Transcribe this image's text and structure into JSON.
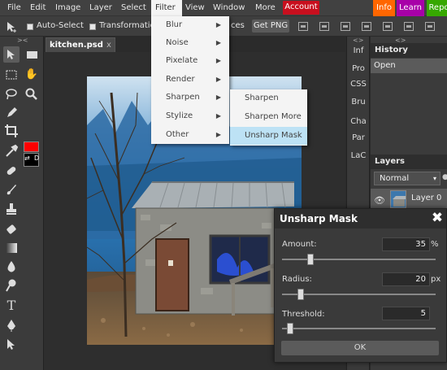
{
  "menubar": {
    "items": [
      "File",
      "Edit",
      "Image",
      "Layer",
      "Select",
      "Filter",
      "View",
      "Window",
      "More"
    ],
    "account": "Account",
    "info": "Info",
    "learn": "Learn",
    "repo": "Repo"
  },
  "options": {
    "auto_select": "Auto-Select",
    "transformation": "Transformation",
    "ces": "ces",
    "get_png": "Get PNG"
  },
  "toolbar": {
    "swap": "⇄",
    "default": "D"
  },
  "document": {
    "tab_title": "kitchen.psd",
    "tab_close": "x"
  },
  "filter_menu": {
    "items": [
      "Blur",
      "Noise",
      "Pixelate",
      "Render",
      "Sharpen",
      "Stylize",
      "Other"
    ],
    "arrow": "▶"
  },
  "sharpen_submenu": {
    "items": [
      "Sharpen",
      "Sharpen More",
      "Unsharp Mask"
    ],
    "highlighted": "Unsharp Mask"
  },
  "mini_panel": {
    "collapse": "<>",
    "items": [
      "Inf",
      "Pro",
      "CSS",
      "Bru",
      "Cha",
      "Par",
      "LaC"
    ]
  },
  "history": {
    "title": "History",
    "collapse": "<>",
    "items": [
      "Open"
    ]
  },
  "layers": {
    "title": "Layers",
    "blend_mode": "Normal",
    "layer_name": "Layer 0"
  },
  "dialog": {
    "title": "Unsharp Mask",
    "close": "✖",
    "amount_label": "Amount:",
    "amount_value": "35",
    "amount_unit": "%",
    "radius_label": "Radius:",
    "radius_value": "20",
    "radius_unit": "px",
    "threshold_label": "Threshold:",
    "threshold_value": "5",
    "ok": "OK"
  },
  "colors": {
    "account": "#c80f1e",
    "info": "#ff6600",
    "learn": "#a800a8",
    "repo": "#36a800",
    "foreground": "#ff0000",
    "background": "#000000",
    "highlight": "#bde2f5"
  }
}
